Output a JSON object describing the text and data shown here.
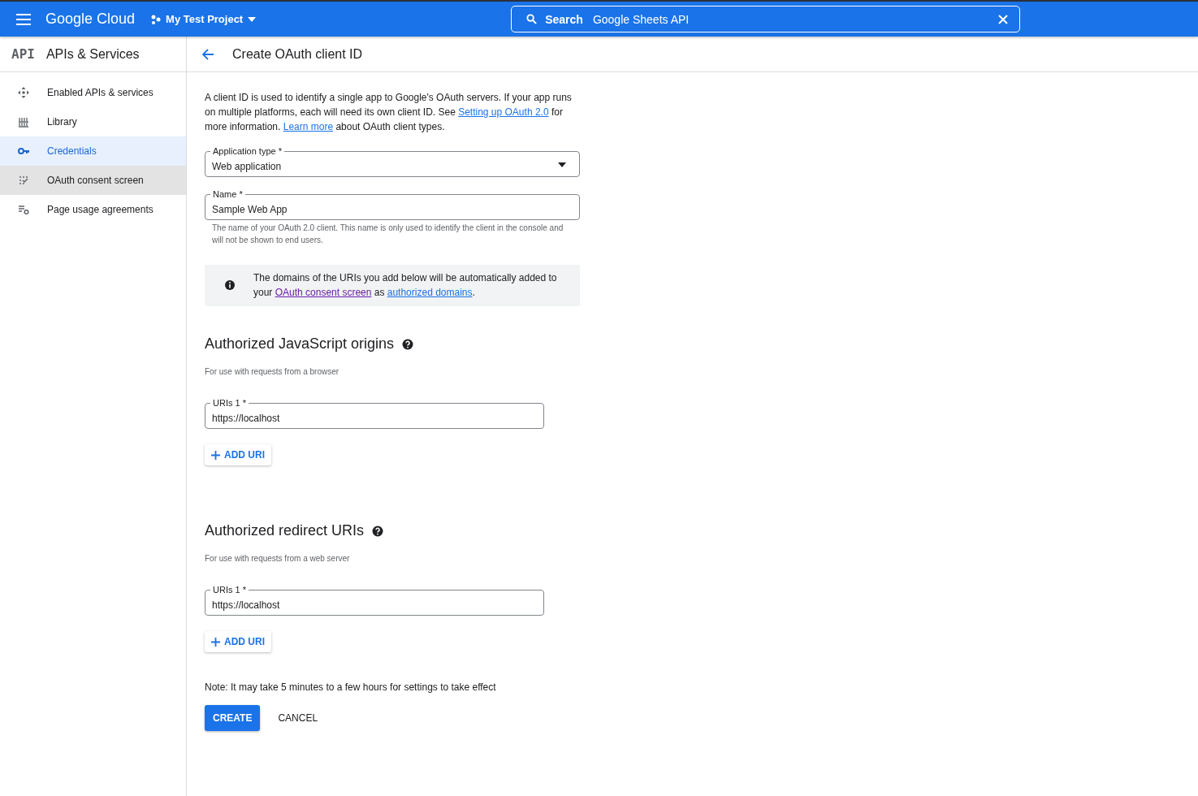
{
  "top_bar": {
    "brand": "Google Cloud",
    "project": "My Test Project",
    "search": {
      "label": "Search",
      "value": "Google Sheets API"
    }
  },
  "sidebar": {
    "title": "APIs & Services",
    "logo": "API",
    "items": [
      {
        "label": "Enabled APIs & services",
        "selected": false,
        "hovered": false
      },
      {
        "label": "Library",
        "selected": false,
        "hovered": false
      },
      {
        "label": "Credentials",
        "selected": true,
        "hovered": false
      },
      {
        "label": "OAuth consent screen",
        "selected": false,
        "hovered": true
      },
      {
        "label": "Page usage agreements",
        "selected": false,
        "hovered": false
      }
    ]
  },
  "page": {
    "title": "Create OAuth client ID",
    "intro": [
      {
        "kind": "text",
        "text": "A client ID is used to identify a single app to Google's OAuth servers. If your app runs on multiple platforms, each will need its own client ID. See "
      },
      {
        "kind": "link",
        "text": "Setting up OAuth 2.0"
      },
      {
        "kind": "text",
        "text": " for more information. "
      },
      {
        "kind": "link",
        "text": "Learn more"
      },
      {
        "kind": "text",
        "text": " about OAuth client types."
      }
    ],
    "application_type": {
      "label": "Application type *",
      "value": "Web application"
    },
    "name": {
      "label": "Name *",
      "value": "Sample Web App",
      "hint": "The name of your OAuth 2.0 client. This name is only used to identify the client in the console and will not be shown to end users."
    },
    "notice": [
      {
        "kind": "text",
        "text": "The domains of the URIs you add below will be automatically added to your "
      },
      {
        "kind": "visited",
        "text": "OAuth consent screen"
      },
      {
        "kind": "text",
        "text": " as "
      },
      {
        "kind": "link",
        "text": "authorized domains"
      },
      {
        "kind": "text",
        "text": "."
      }
    ],
    "sections": [
      {
        "title": "Authorized JavaScript origins",
        "subtitle": "For use with requests from a browser",
        "uris": [
          {
            "label": "URIs 1 *",
            "value": "https://localhost"
          }
        ],
        "add_button": "ADD URI"
      },
      {
        "title": "Authorized redirect URIs",
        "subtitle": "For use with requests from a web server",
        "uris": [
          {
            "label": "URIs 1 *",
            "value": "https://localhost"
          }
        ],
        "add_button": "ADD URI"
      }
    ],
    "note": "Note: It may take 5 minutes to a few hours for settings to take effect",
    "buttons": [
      {
        "label": "CREATE",
        "kind": "primary"
      },
      {
        "label": "CANCEL",
        "kind": "text"
      }
    ]
  }
}
